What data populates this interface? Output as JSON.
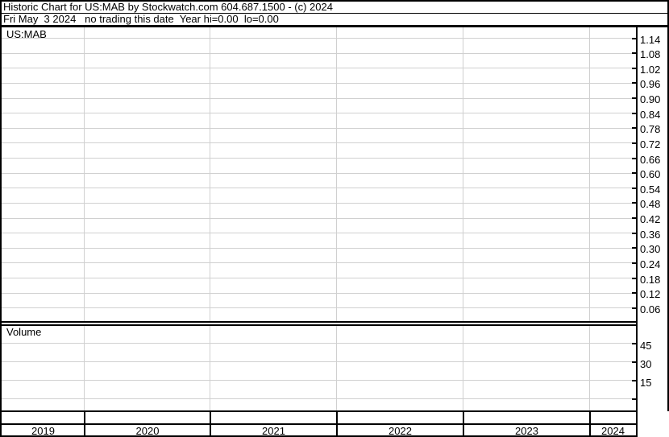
{
  "header": {
    "line1": "Historic Chart for US:MAB by Stockwatch.com 604.687.1500 - (c) 2024",
    "line2": "Fri May  3 2024   no trading this date  Year hi=0.00  lo=0.00"
  },
  "price_panel": {
    "symbol_label": "US:MAB",
    "axis_labels": [
      "1.14",
      "1.08",
      "1.02",
      "0.96",
      "0.90",
      "0.84",
      "0.78",
      "0.72",
      "0.66",
      "0.60",
      "0.54",
      "0.48",
      "0.42",
      "0.36",
      "0.30",
      "0.24",
      "0.18",
      "0.12",
      "0.06"
    ]
  },
  "volume_panel": {
    "label": "Volume",
    "axis_labels": [
      "45",
      "30",
      "15"
    ]
  },
  "x_axis": {
    "years": [
      "2019",
      "2020",
      "2021",
      "2022",
      "2023",
      "2024"
    ]
  },
  "colors": {
    "grid": "#d0d0d0",
    "border": "#000000",
    "text": "#000000",
    "background": "#ffffff"
  },
  "chart_data": [
    {
      "type": "line",
      "panel": "price",
      "title": "US:MAB",
      "xlabel": "",
      "ylabel": "",
      "x_categories": [
        "2019",
        "2020",
        "2021",
        "2022",
        "2023",
        "2024"
      ],
      "series": [],
      "yticks": [
        1.14,
        1.08,
        1.02,
        0.96,
        0.9,
        0.84,
        0.78,
        0.72,
        0.66,
        0.6,
        0.54,
        0.48,
        0.42,
        0.36,
        0.3,
        0.24,
        0.18,
        0.12,
        0.06
      ],
      "ylim": [
        0,
        1.2
      ],
      "grid": true,
      "legend": "none",
      "annotation": "no trading this date; Year hi=0.00 lo=0.00 - chart area is empty"
    },
    {
      "type": "bar",
      "panel": "volume",
      "title": "Volume",
      "x_categories": [
        "2019",
        "2020",
        "2021",
        "2022",
        "2023",
        "2024"
      ],
      "values": [],
      "yticks": [
        45,
        30,
        15
      ],
      "ylim": [
        0,
        55
      ],
      "grid": true,
      "legend": "none",
      "annotation": "no volume data plotted - chart area is empty"
    }
  ]
}
